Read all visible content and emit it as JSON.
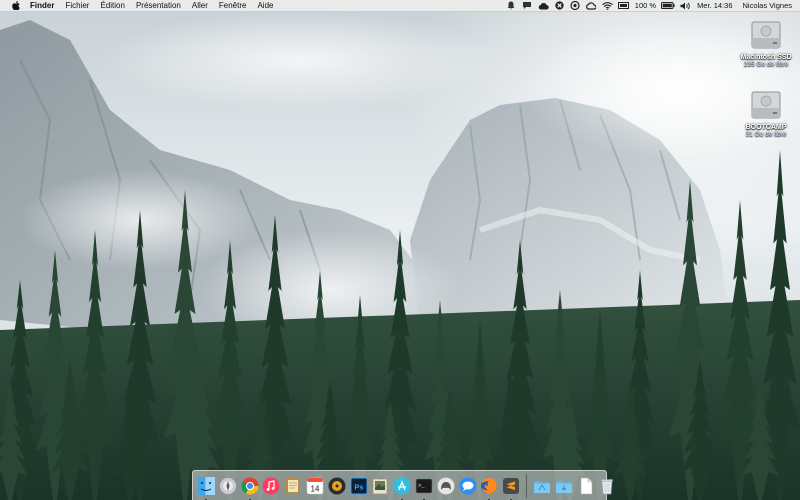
{
  "menubar": {
    "app_name": "Finder",
    "menus": [
      "Fichier",
      "Édition",
      "Présentation",
      "Aller",
      "Fenêtre",
      "Aide"
    ],
    "status_icons": [
      "notification-badge-icon",
      "chat-icon",
      "cloud-sync-icon",
      "dropbox-icon",
      "vpn-icon",
      "creative-cloud-icon",
      "wifi-icon",
      "airplay-icon",
      "volume-icon"
    ],
    "battery_percent": "100 %",
    "clock": "Mer. 14:36",
    "user": "Nicolas Vignes"
  },
  "desktop": {
    "disks": [
      {
        "name": "Macintosh SSD",
        "subtitle": "235 Go de libre"
      },
      {
        "name": "BOOTCAMP",
        "subtitle": "31 Go de libre"
      }
    ]
  },
  "dock": {
    "apps": [
      {
        "icon": "finder-icon",
        "running": true
      },
      {
        "icon": "launchpad-icon",
        "running": false
      },
      {
        "icon": "chrome-icon",
        "running": true
      },
      {
        "icon": "itunes-icon",
        "running": false
      },
      {
        "icon": "notes-icon",
        "running": false
      },
      {
        "icon": "calendar-icon",
        "running": false
      },
      {
        "icon": "audio-app-icon",
        "running": false
      },
      {
        "icon": "photoshop-icon",
        "running": false
      },
      {
        "icon": "preview-icon",
        "running": false
      },
      {
        "icon": "app-store-icon",
        "running": true
      },
      {
        "icon": "terminal-icon",
        "running": true
      },
      {
        "icon": "sequel-pro-icon",
        "running": false
      },
      {
        "icon": "messages-icon",
        "running": false
      },
      {
        "icon": "firefox-icon",
        "running": true
      },
      {
        "icon": "sublime-text-icon",
        "running": true
      }
    ],
    "calendar_day": "14",
    "photoshop_label": "Ps",
    "terminal_prompt": ">_",
    "stack_items": [
      "applications-folder-icon",
      "downloads-folder-icon",
      "document-icon",
      "trash-icon"
    ]
  }
}
